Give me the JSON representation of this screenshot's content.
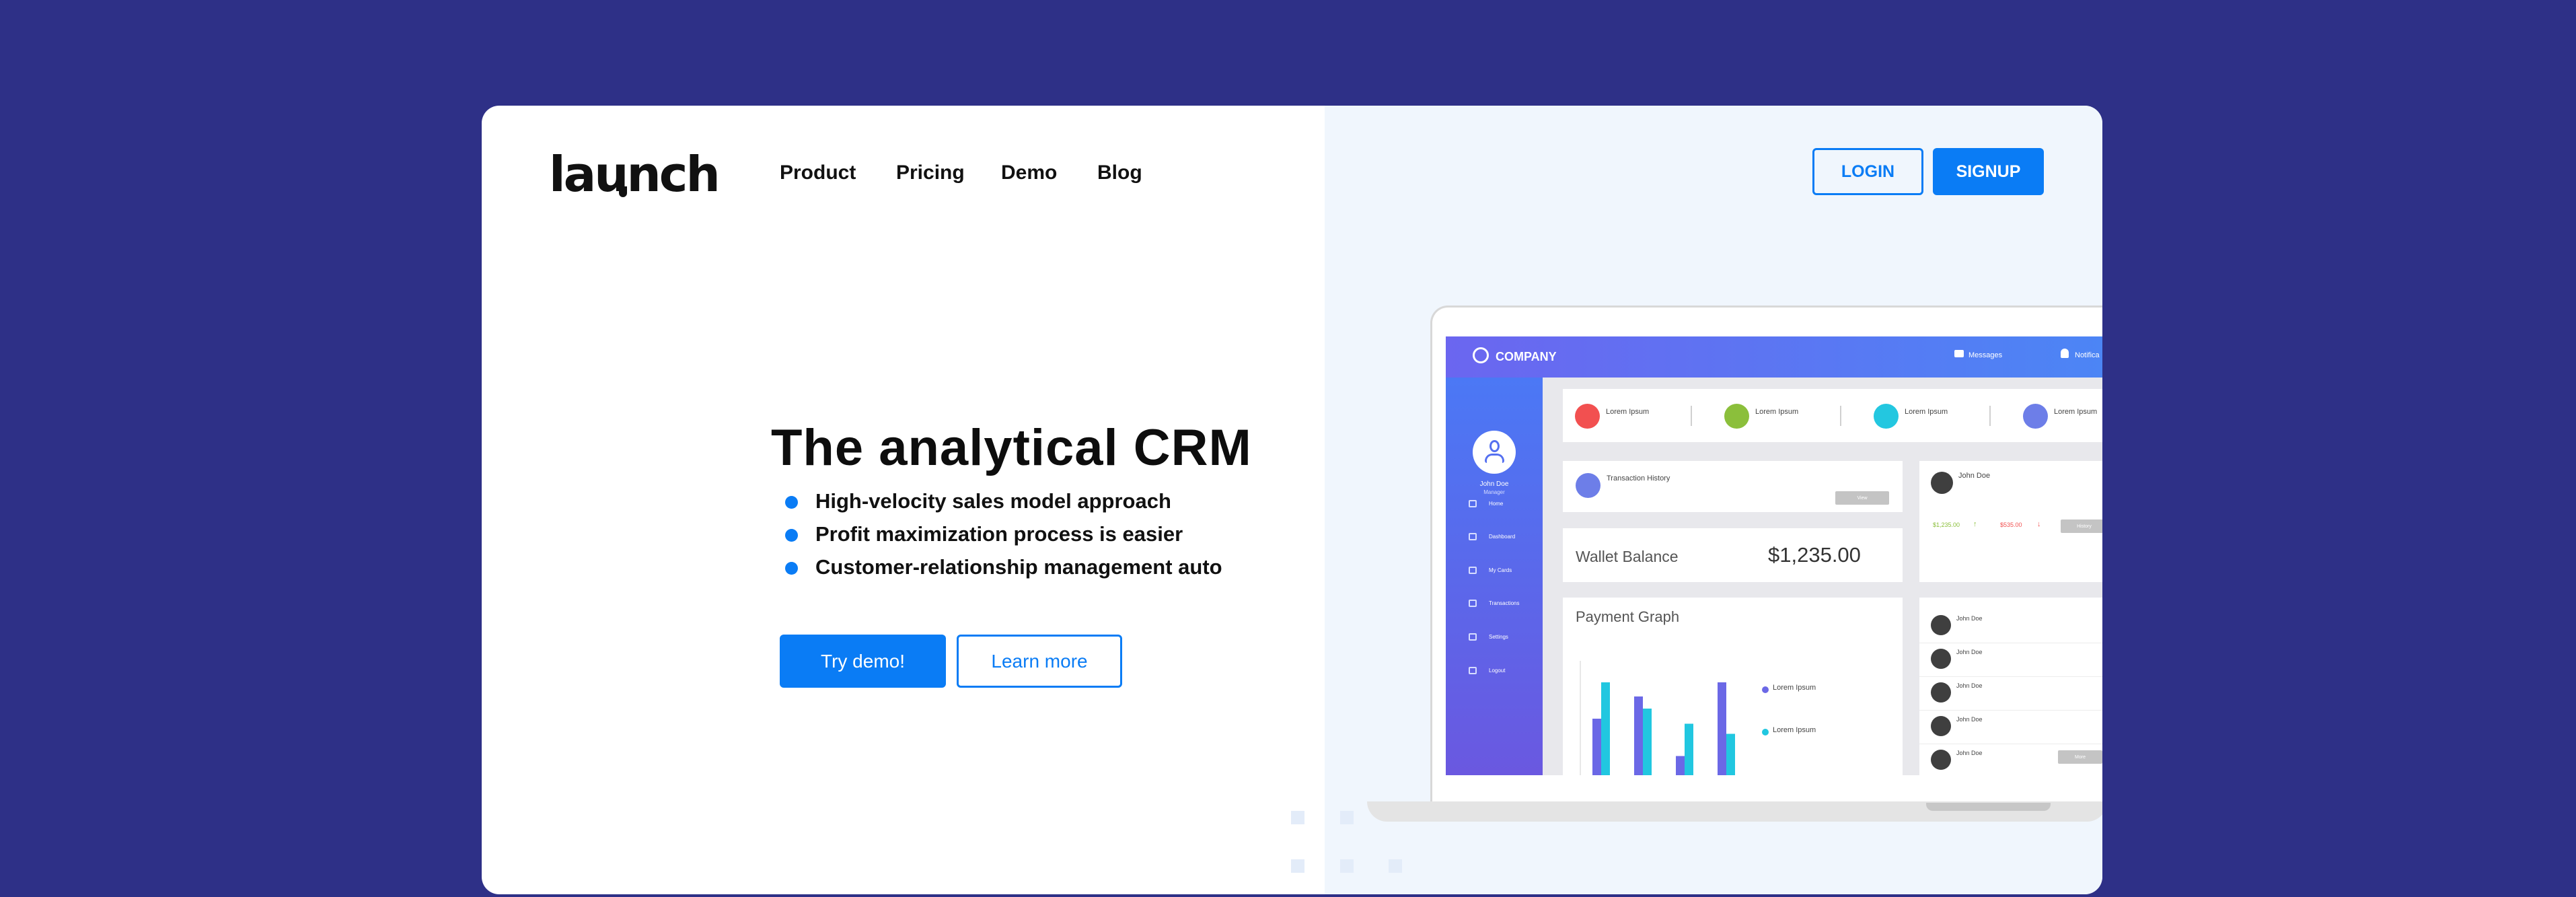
{
  "brand": {
    "logo_text": "launch"
  },
  "nav": {
    "items": [
      "Product",
      "Pricing",
      "Demo",
      "Blog"
    ]
  },
  "auth": {
    "login_label": "LOGIN",
    "signup_label": "SIGNUP"
  },
  "hero": {
    "headline": "The analytical CRM",
    "bullets": [
      "High-velocity sales model approach",
      "Profit maximization process is easier",
      "Customer-relationship management auto"
    ],
    "primary_cta": "Try demo!",
    "secondary_cta": "Learn more"
  },
  "dashboard": {
    "company": "COMPANY",
    "messages_label": "Messages",
    "notifications_label": "Notifica",
    "user": {
      "name": "John Doe",
      "role": "Manager"
    },
    "sidebar_items": [
      "Home",
      "Dashboard",
      "My Cards",
      "Transactions",
      "Settings",
      "Logout"
    ],
    "stats": [
      {
        "label": "Lorem Ipsum",
        "color": "#f25050"
      },
      {
        "label": "Lorem Ipsum",
        "color": "#8bbf3b"
      },
      {
        "label": "Lorem Ipsum",
        "color": "#23c7e0"
      },
      {
        "label": "Lorem Ipsum",
        "color": "#6d7ee8"
      }
    ],
    "transaction": {
      "title": "Transaction History",
      "button": "View"
    },
    "wallet": {
      "label": "Wallet Balance",
      "value": "$1,235.00"
    },
    "payment_graph": {
      "title": "Payment Graph"
    },
    "legend": [
      {
        "label": "Lorem Ipsum",
        "color": "#6b68e6"
      },
      {
        "label": "Lorem Ipsum",
        "color": "#21c7e0"
      }
    ],
    "profile_card": {
      "name": "John Doe",
      "amount_up": "$1,235.00",
      "amount_down": "$535.00",
      "button": "History"
    },
    "contacts": [
      "John Doe",
      "John Doe",
      "John Doe",
      "John Doe",
      "John Doe"
    ],
    "more_button": "More",
    "graph_values": {
      "series_a": [
        0.56,
        0.78,
        0.19,
        0.92
      ],
      "series_b": [
        0.92,
        0.66,
        0.51,
        0.41
      ]
    }
  }
}
